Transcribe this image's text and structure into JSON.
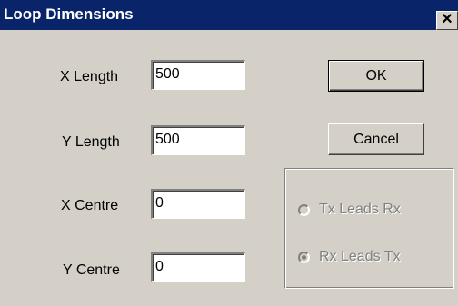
{
  "window": {
    "title": "Loop Dimensions",
    "close_glyph": "✕"
  },
  "fields": [
    {
      "label": "X Length",
      "value": "500"
    },
    {
      "label": "Y Length",
      "value": "500"
    },
    {
      "label": "X Centre",
      "value": "0"
    },
    {
      "label": "Y Centre",
      "value": "0"
    }
  ],
  "buttons": {
    "ok": "OK",
    "cancel": "Cancel"
  },
  "radios": [
    {
      "label": "Tx Leads Rx",
      "checked": false,
      "enabled": false
    },
    {
      "label": "Rx Leads Tx",
      "checked": true,
      "enabled": false
    }
  ]
}
